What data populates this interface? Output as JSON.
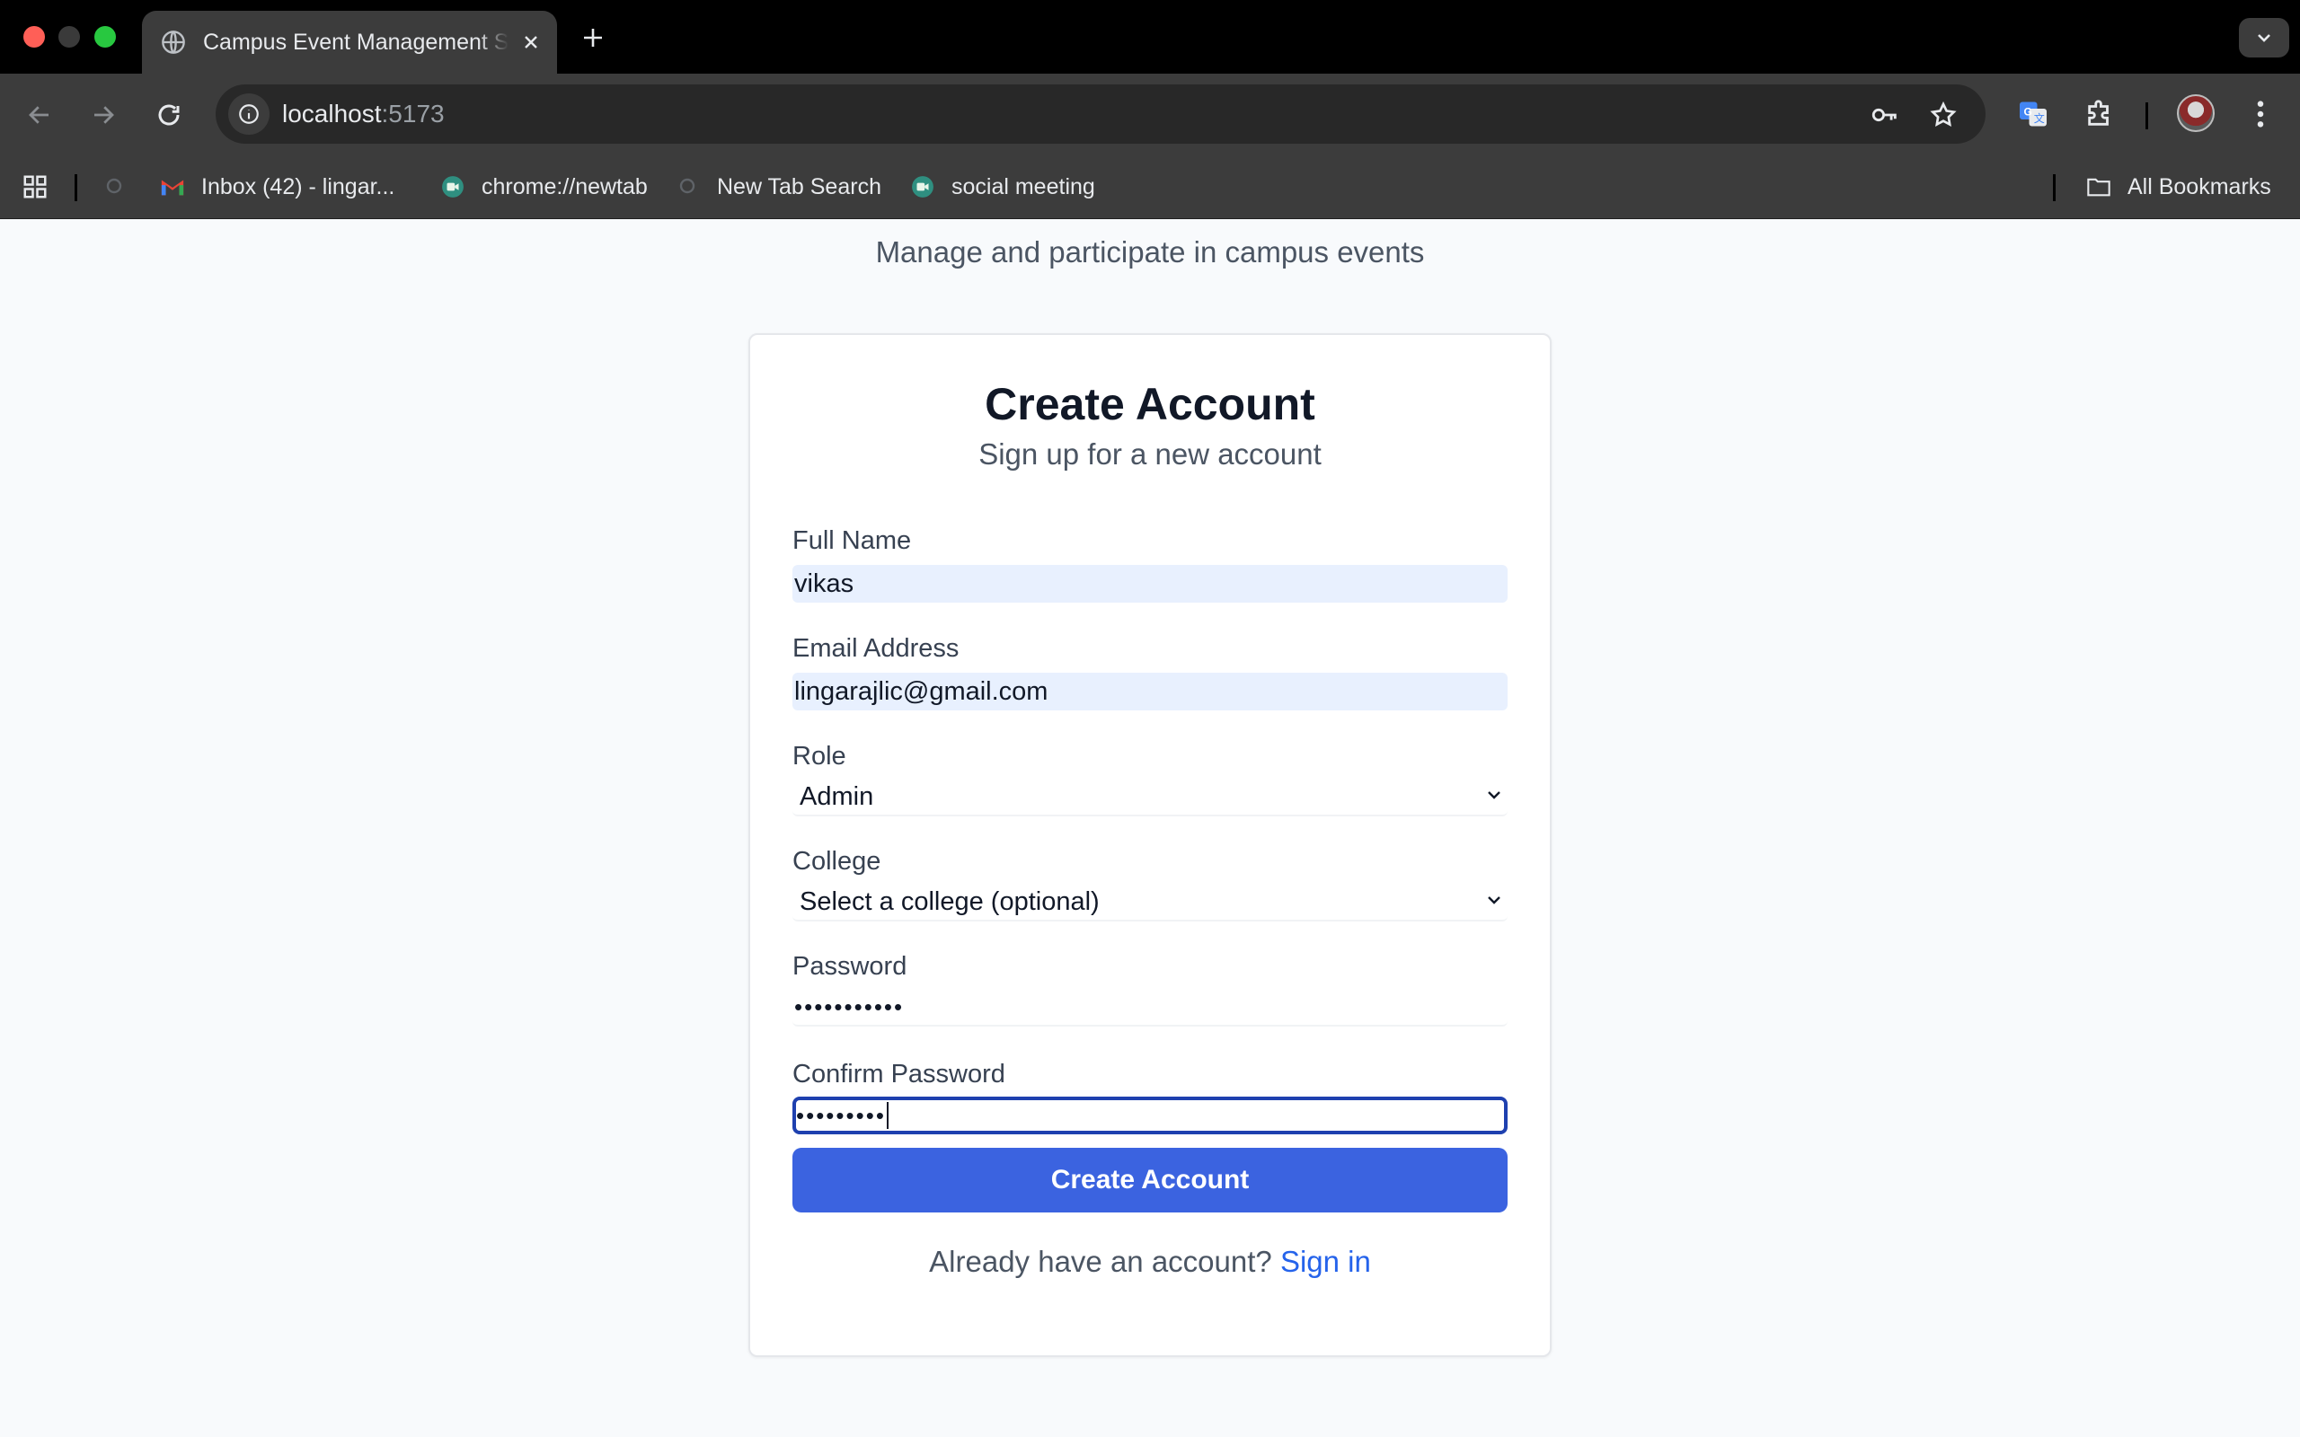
{
  "browser": {
    "tab_title": "Campus Event Management S",
    "url_host": "localhost",
    "url_port": ":5173",
    "bookmarks": [
      {
        "label": "Inbox (42) - lingar...",
        "icon": "gmail-icon"
      },
      {
        "label": "chrome://newtab",
        "icon": "meet-icon"
      },
      {
        "label": "New Tab Search",
        "icon": "search-icon"
      },
      {
        "label": "social meeting",
        "icon": "meet-icon"
      }
    ],
    "all_bookmarks": "All Bookmarks"
  },
  "page": {
    "subtitle": "Manage and participate in campus events"
  },
  "form": {
    "title": "Create Account",
    "subtitle": "Sign up for a new account",
    "fields": {
      "full_name": {
        "label": "Full Name",
        "value": "vikas"
      },
      "email": {
        "label": "Email Address",
        "value": "lingarajlic@gmail.com"
      },
      "role": {
        "label": "Role",
        "value": "Admin"
      },
      "college": {
        "label": "College",
        "value": "Select a college (optional)"
      },
      "password": {
        "label": "Password",
        "value": "•••••••••••"
      },
      "confirm_password": {
        "label": "Confirm Password",
        "value": "•••••••••"
      }
    },
    "submit_label": "Create Account",
    "footer_text": "Already have an account?",
    "footer_link": "Sign in"
  },
  "colors": {
    "primary_button": "#3b63e0",
    "link": "#2563eb",
    "autofill_bg": "#e8f0fe",
    "focus_ring": "#1e40af"
  }
}
